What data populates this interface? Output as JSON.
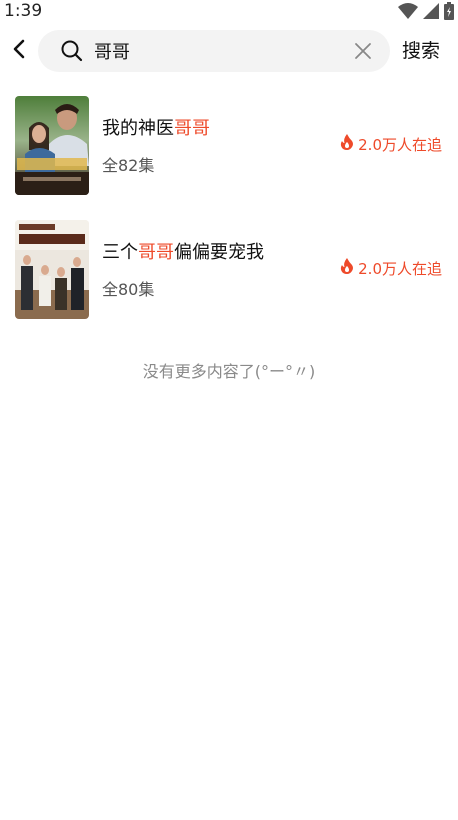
{
  "status": {
    "time": "1:39"
  },
  "search": {
    "query": "哥哥",
    "placeholder": "",
    "submit_label": "搜索"
  },
  "results": [
    {
      "title_before": "我的神医",
      "title_highlight": "哥哥",
      "title_after": "",
      "episodes": "全82集",
      "popularity": "2.0万人在追"
    },
    {
      "title_before": "三个",
      "title_highlight": "哥哥",
      "title_after": "偏偏要宠我",
      "episodes": "全80集",
      "popularity": "2.0万人在追"
    }
  ],
  "end_message": "没有更多内容了(°ー°〃)",
  "colors": {
    "accent": "#ee4a2a",
    "search_bg": "#f3f3f3"
  }
}
